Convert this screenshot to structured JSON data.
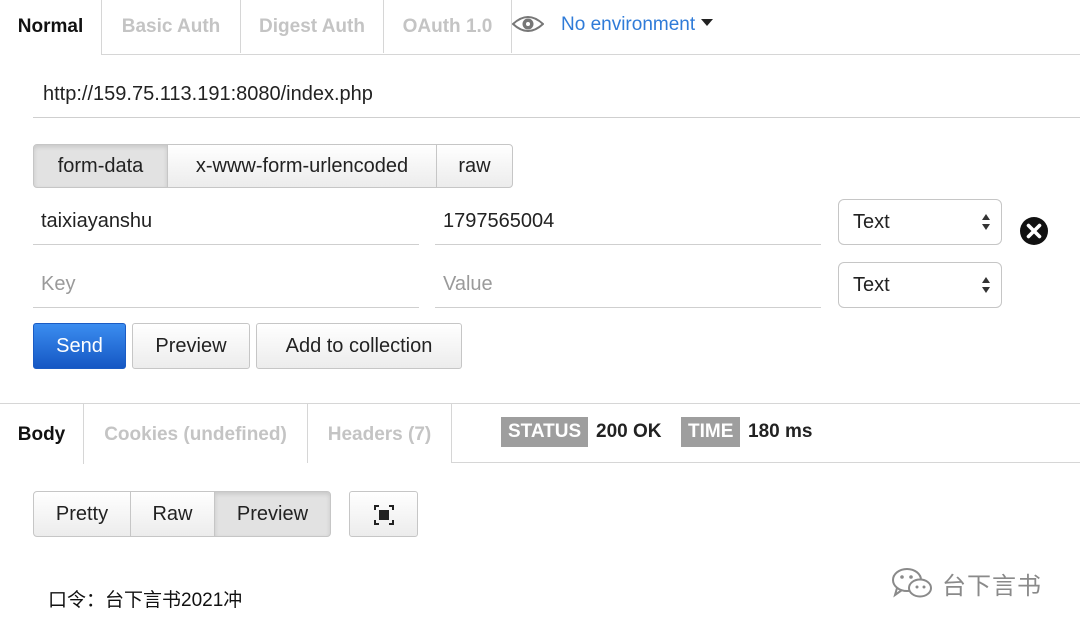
{
  "auth_tabs": [
    "Normal",
    "Basic Auth",
    "Digest Auth",
    "OAuth 1.0"
  ],
  "environment": {
    "label": "No environment"
  },
  "url": {
    "value": "http://159.75.113.191:8080/index.php"
  },
  "body_types": [
    "form-data",
    "x-www-form-urlencoded",
    "raw"
  ],
  "form_rows": [
    {
      "key": "taixiayanshu",
      "value": "1797565004",
      "type": "Text"
    },
    {
      "key_placeholder": "Key",
      "value_placeholder": "Value",
      "type": "Text"
    }
  ],
  "actions": {
    "send": "Send",
    "preview": "Preview",
    "add_to_collection": "Add to collection"
  },
  "response_tabs": [
    "Body",
    "Cookies (undefined)",
    "Headers (7)"
  ],
  "status": {
    "label": "STATUS",
    "value": "200 OK"
  },
  "time": {
    "label": "TIME",
    "value": "180 ms"
  },
  "view_modes": [
    "Pretty",
    "Raw",
    "Preview"
  ],
  "response_body": "口令：台下言书2021冲",
  "watermark": "台下言书",
  "colors": {
    "accent": "#2f7bd8",
    "send": "#1557c4",
    "badge": "#9e9e9e"
  }
}
